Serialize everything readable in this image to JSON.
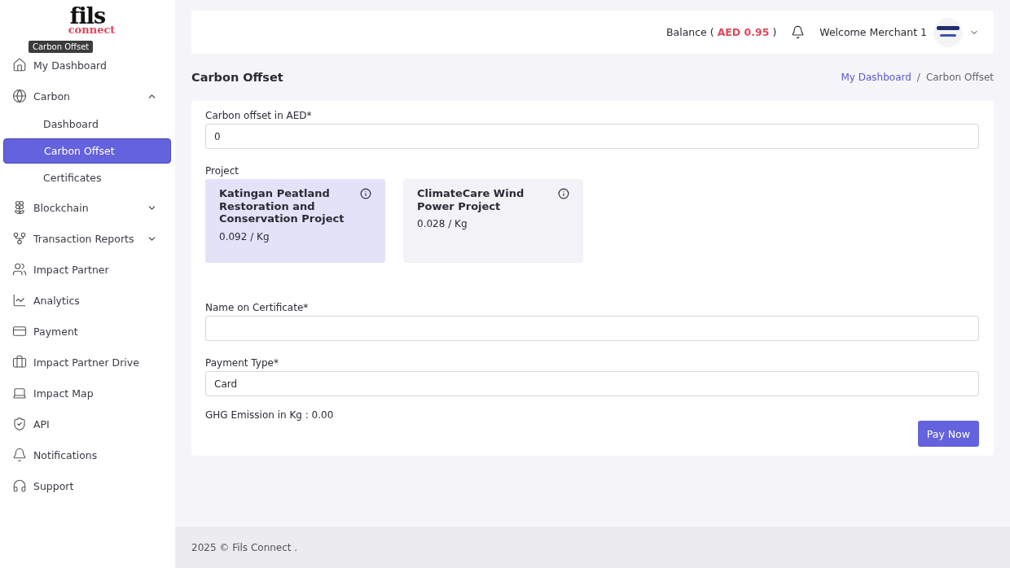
{
  "logo": {
    "word": "fils",
    "sub": "connect"
  },
  "tooltip": "Carbon Offset",
  "sidebar": {
    "items": [
      {
        "label": "My Dashboard"
      },
      {
        "label": "Carbon",
        "expanded": true,
        "children": [
          {
            "label": "Dashboard",
            "selected": false
          },
          {
            "label": "Carbon Offset",
            "selected": true
          },
          {
            "label": "Certificates",
            "selected": false
          }
        ]
      },
      {
        "label": "Blockchain",
        "expanded": false
      },
      {
        "label": "Transaction Reports",
        "expanded": false
      },
      {
        "label": "Impact Partner"
      },
      {
        "label": "Analytics"
      },
      {
        "label": "Payment"
      },
      {
        "label": "Impact Partner Drive"
      },
      {
        "label": "Impact Map"
      },
      {
        "label": "API"
      },
      {
        "label": "Notifications"
      },
      {
        "label": "Support"
      }
    ]
  },
  "header": {
    "balance_label": "Balance (",
    "balance_value": "AED 0.95",
    "balance_close": ")",
    "welcome": "Welcome Merchant 1"
  },
  "page_title": "Carbon Offset",
  "breadcrumb": [
    {
      "label": "My Dashboard",
      "link": true
    },
    {
      "label": "Carbon Offset",
      "link": false
    }
  ],
  "breadcrumb_separator": "/",
  "form": {
    "amount": {
      "label": "Carbon offset in AED*",
      "value": "0"
    },
    "project_label": "Project",
    "projects": [
      {
        "name": "Katingan Peatland Restoration and Conservation Project",
        "price": "0.092 / Kg",
        "selected": true
      },
      {
        "name": "ClimateCare Wind Power Project",
        "price": "0.028 / Kg",
        "selected": false
      }
    ],
    "certificate_name": {
      "label": "Name on Certificate*"
    },
    "payment_type": {
      "label": "Payment Type*",
      "value": "Card"
    },
    "ghg": "GHG Emission in Kg : 0.00",
    "submit": "Pay Now"
  },
  "footer": "2025 © Fils Connect ."
}
